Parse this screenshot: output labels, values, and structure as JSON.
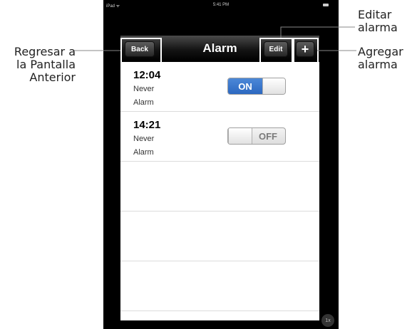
{
  "status_bar": {
    "carrier": "iPad ᯤ",
    "time": "5:41 PM"
  },
  "navbar": {
    "title": "Alarm",
    "back_label": "Back",
    "edit_label": "Edit",
    "add_label": "+"
  },
  "alarms": [
    {
      "time": "12:04",
      "repeat": "Never",
      "label": "Alarm",
      "toggle": "ON"
    },
    {
      "time": "14:21",
      "repeat": "Never",
      "label": "Alarm",
      "toggle": "OFF"
    }
  ],
  "annotations": {
    "back": [
      "Regresar a",
      "la Pantalla",
      "Anterior"
    ],
    "edit": [
      "Editar",
      "alarma"
    ],
    "add": [
      "Agregar",
      "alarma"
    ]
  },
  "zoom_badge": "1x",
  "colors": {
    "toggle_on": "#2c68c0",
    "navbar": "#141414"
  }
}
